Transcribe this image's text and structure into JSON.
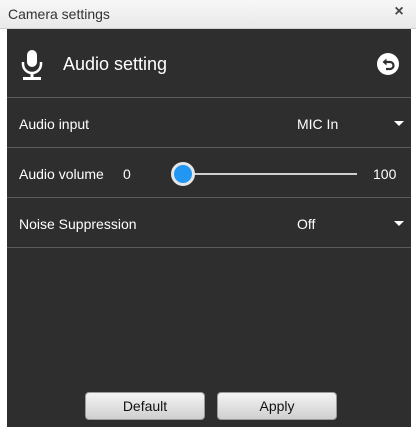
{
  "window": {
    "title": "Camera settings",
    "close_glyph": "×"
  },
  "header": {
    "title": "Audio setting",
    "icon": "microphone-icon",
    "back_icon": "back-arrow-icon"
  },
  "settings": {
    "audio_input": {
      "label": "Audio input",
      "value": "MIC In"
    },
    "audio_volume": {
      "label": "Audio volume",
      "min": "0",
      "max": "100",
      "value": 0
    },
    "noise_suppression": {
      "label": "Noise Suppression",
      "value": "Off"
    }
  },
  "buttons": {
    "default_label": "Default",
    "apply_label": "Apply"
  },
  "colors": {
    "panel_bg": "#2e2e2e",
    "divider": "#5a5a5a",
    "slider_accent": "#2196f3"
  }
}
